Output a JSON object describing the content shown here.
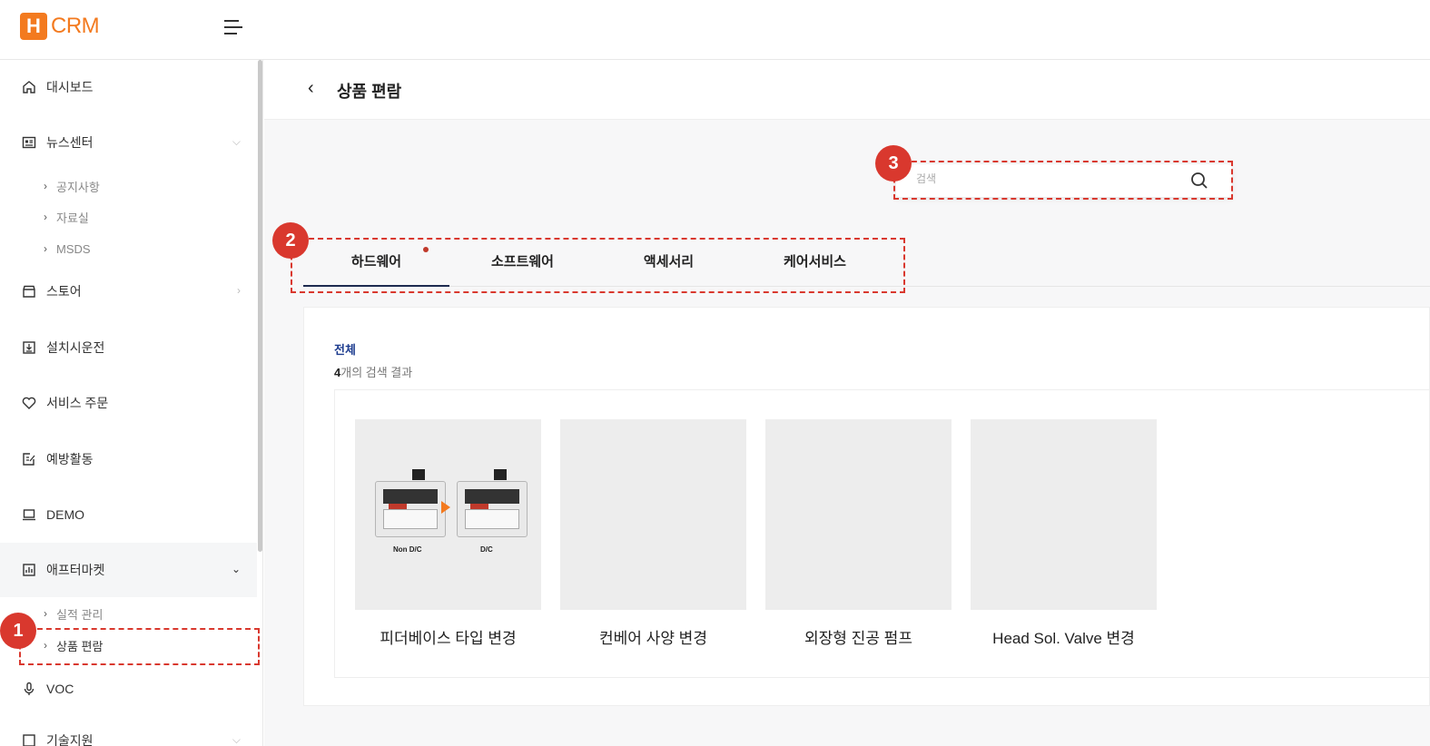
{
  "app": {
    "logo_mark": "H",
    "logo_text": "CRM"
  },
  "sidebar": {
    "items": [
      {
        "label": "대시보드"
      },
      {
        "label": "뉴스센터"
      },
      {
        "label": "스토어"
      },
      {
        "label": "설치시운전"
      },
      {
        "label": "서비스 주문"
      },
      {
        "label": "예방활동"
      },
      {
        "label": "DEMO"
      },
      {
        "label": "애프터마켓"
      },
      {
        "label": "VOC"
      },
      {
        "label": "기술지원"
      }
    ],
    "news_sub": [
      "공지사항",
      "자료실",
      "MSDS"
    ],
    "aftermarket_sub": [
      "실적 관리",
      "상품 편람"
    ]
  },
  "page": {
    "title": "상품 편람"
  },
  "search": {
    "placeholder": "검색"
  },
  "tabs": [
    {
      "label": "하드웨어",
      "active": true
    },
    {
      "label": "소프트웨어"
    },
    {
      "label": "액세서리"
    },
    {
      "label": "케어서비스"
    }
  ],
  "results": {
    "category": "전체",
    "count": "4",
    "count_suffix": "개의 검색 결과",
    "products": [
      {
        "name": "피더베이스 타입 변경"
      },
      {
        "name": "컨베어 사양 변경"
      },
      {
        "name": "외장형 진공 펌프"
      },
      {
        "name": "Head Sol. Valve 변경"
      }
    ],
    "image_labels": {
      "left": "Non D/C",
      "right": "D/C"
    }
  },
  "annotations": [
    "1",
    "2",
    "3"
  ],
  "colors": {
    "brand": "#f37a1f",
    "annotation": "#d9382e",
    "tab_active": "#1d2a4f"
  }
}
